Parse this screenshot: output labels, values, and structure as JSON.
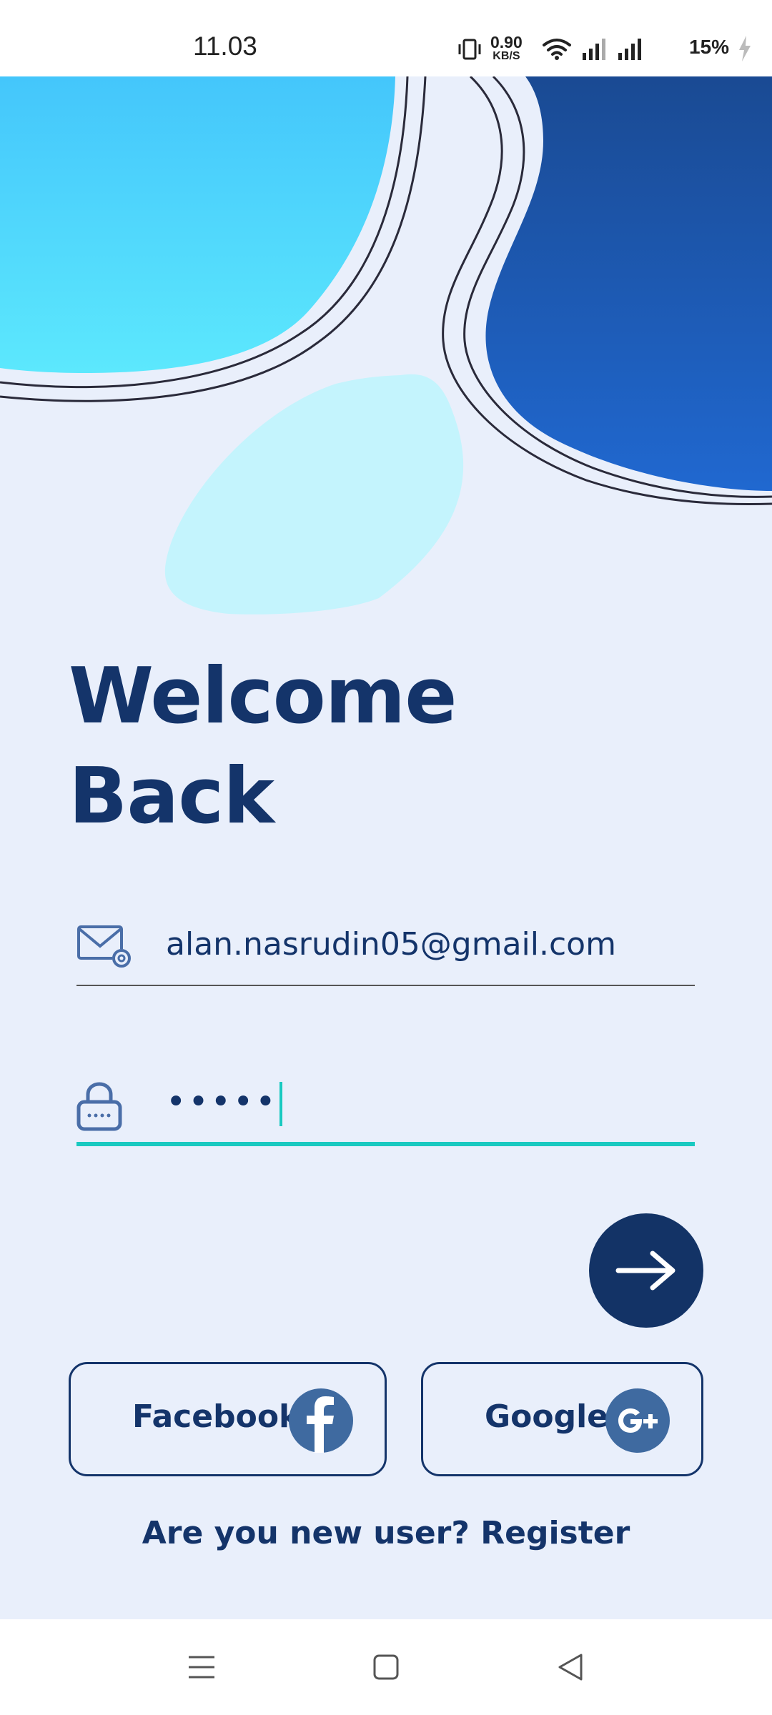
{
  "status_bar": {
    "time": "11.03",
    "net_speed_value": "0.90",
    "net_speed_unit": "KB/S",
    "battery_percent": "15%",
    "icons": [
      "vibrate-icon",
      "wifi-icon",
      "signal-icon",
      "signal-icon",
      "charging-icon"
    ]
  },
  "login": {
    "title_line1": "Welcome",
    "title_line2": "Back",
    "email_value": "alan.nasrudin05@gmail.com",
    "password_masked": "•••••",
    "submit_icon": "arrow-right-icon"
  },
  "social": {
    "facebook_label": "Facebook",
    "google_label": "Google"
  },
  "register": {
    "prompt": "Are you new user?",
    "link": "Register"
  },
  "colors": {
    "background": "#e9effb",
    "primary": "#14346a",
    "accent": "#19c9c0",
    "blob_light": "#4fd8fb",
    "blob_dark": "#1f63c8",
    "blob_pale": "#c4f4fd"
  },
  "nav_bar": {
    "icons": [
      "menu-icon",
      "home-icon",
      "back-icon"
    ]
  }
}
